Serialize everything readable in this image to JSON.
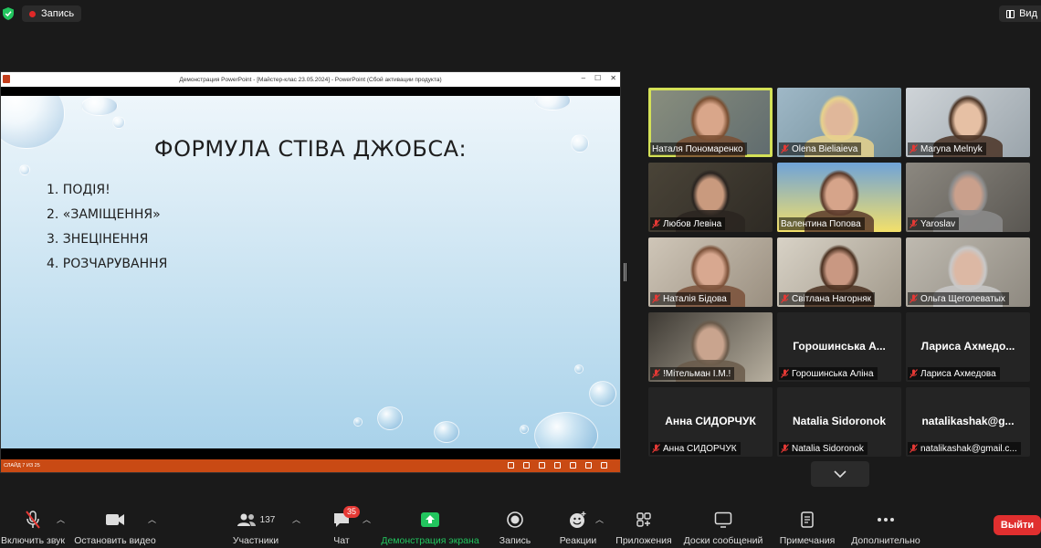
{
  "topbar": {
    "recording_label": "Запись",
    "view_label": "Вид"
  },
  "share": {
    "window_title": "Демонстрация PowerPoint - [Майстер-клас 23.05.2024] - PowerPoint (Сбой активации продукта)",
    "status_text": "СЛАЙД 7 ИЗ 25",
    "slide": {
      "title": "ФОРМУЛА СТІВА ДЖОБСА:",
      "items": [
        "1. ПОДІЯ!",
        "2. «ЗАМІЩЕННЯ»",
        "3. ЗНЕЦІНЕННЯ",
        "4. РОЗЧАРУВАННЯ"
      ]
    }
  },
  "participants": [
    {
      "name": "Наталя Пономаренко",
      "muted": false,
      "video": true,
      "active": true
    },
    {
      "name": "Olena Bieliaieva",
      "muted": true,
      "video": true
    },
    {
      "name": "Maryna Melnyk",
      "muted": true,
      "video": true
    },
    {
      "name": "Любов Левіна",
      "muted": true,
      "video": true
    },
    {
      "name": "Валентина Попова",
      "muted": false,
      "video": true
    },
    {
      "name": "Yaroslav",
      "muted": true,
      "video": true
    },
    {
      "name": "Наталія Бідова",
      "muted": true,
      "video": true
    },
    {
      "name": "Світлана Нагорняк",
      "muted": true,
      "video": true
    },
    {
      "name": "Ольга Щеголеватых",
      "muted": true,
      "video": true
    },
    {
      "name": "!Мітельман І.М.!",
      "muted": true,
      "video": true
    },
    {
      "name": "Горошинська Аліна",
      "display_name": "Горошинська А...",
      "muted": true,
      "video": false
    },
    {
      "name": "Лариса Ахмедова",
      "display_name": "Лариса Ахмедо...",
      "muted": true,
      "video": false
    },
    {
      "name": "Анна СИДОРЧУК",
      "display_name": "Анна СИДОРЧУК",
      "muted": true,
      "video": false
    },
    {
      "name": "Natalia Sidoronok",
      "display_name": "Natalia Sidoronok",
      "muted": true,
      "video": false
    },
    {
      "name": "natalikashak@gmail.c...",
      "display_name": "natalikashak@g...",
      "muted": true,
      "video": false
    }
  ],
  "toolbar": {
    "unmute": "Включить звук",
    "stop_video": "Остановить видео",
    "participants": "Участники",
    "participants_count": "137",
    "chat": "Чат",
    "chat_badge": "35",
    "share_screen": "Демонстрация экрана",
    "record": "Запись",
    "reactions": "Реакции",
    "apps": "Приложения",
    "whiteboards": "Доски сообщений",
    "notes": "Примечания",
    "more": "Дополнительно",
    "leave": "Выйти"
  },
  "colors": {
    "leave": "#e02f2f",
    "share_green": "#22c55e",
    "active_speaker": "#d4e157",
    "mute_red": "#e53935"
  }
}
